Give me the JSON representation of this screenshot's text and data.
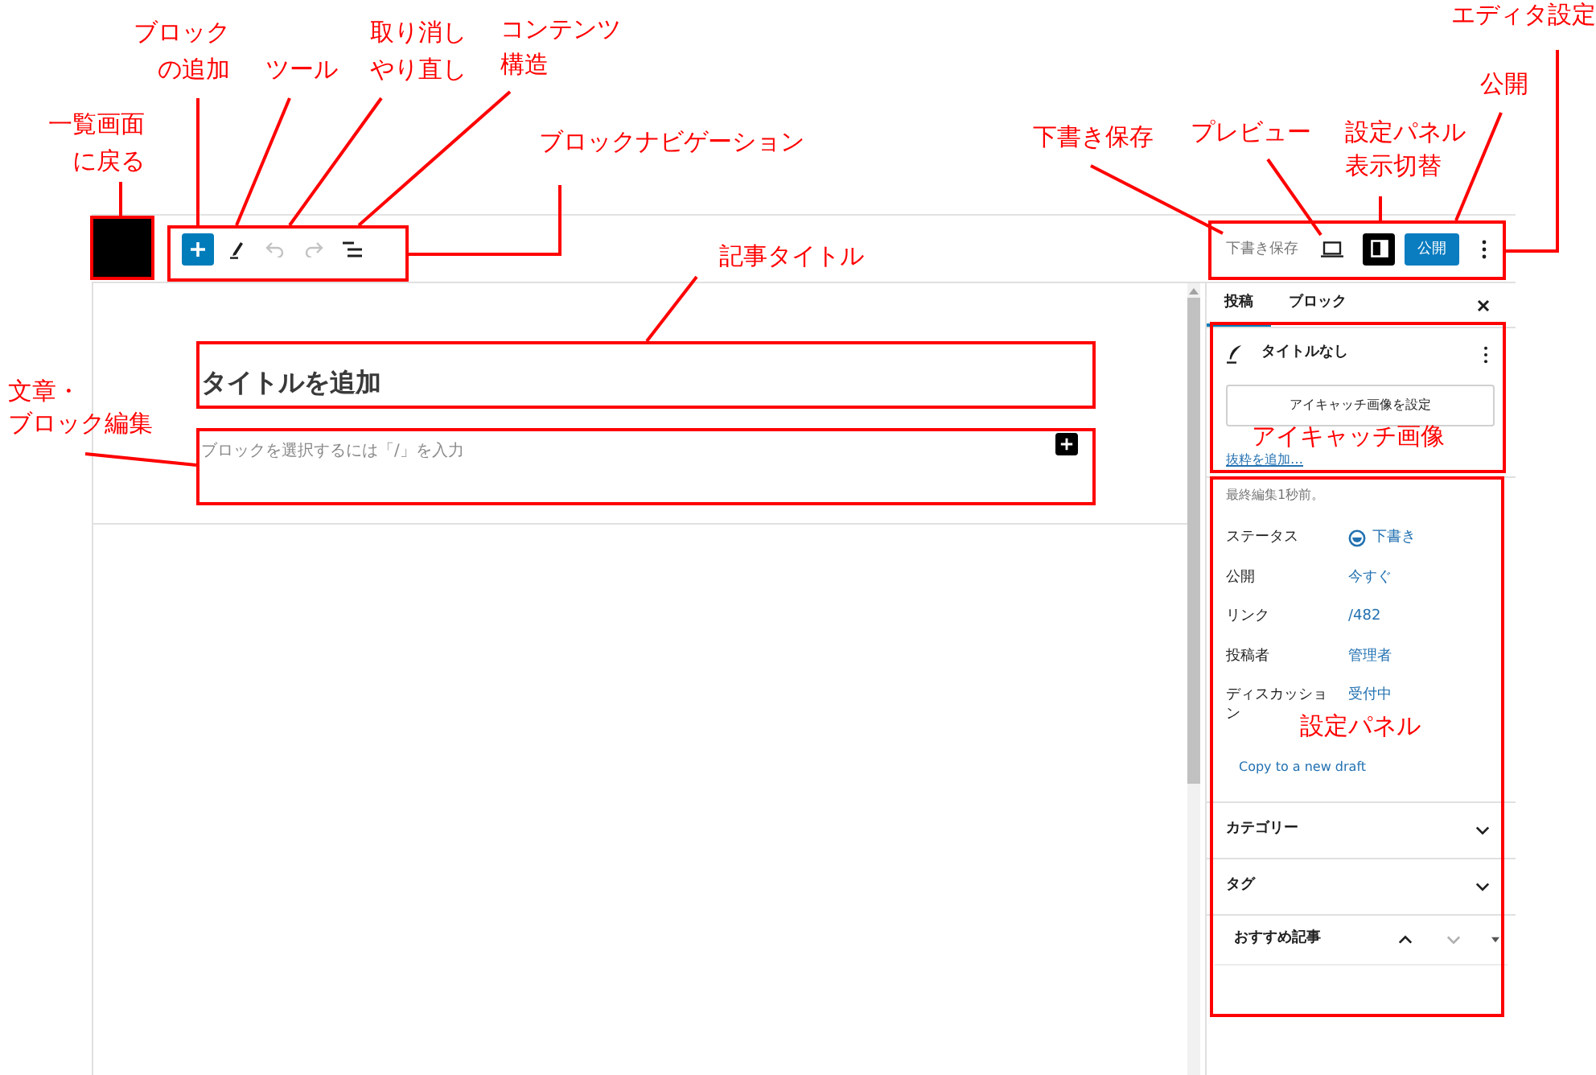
{
  "annotations": [
    {
      "lines": [
        "一覧画面",
        "に戻る"
      ]
    },
    {
      "lines": [
        "ブロック",
        "の追加"
      ]
    },
    {
      "lines": [
        "ツール"
      ]
    },
    {
      "lines": [
        "取り消し",
        "やり直し"
      ]
    },
    {
      "lines": [
        "コンテンツ",
        "構造"
      ]
    },
    {
      "lines": [
        "ブロックナビゲーション"
      ]
    },
    {
      "lines": [
        "記事タイトル"
      ]
    },
    {
      "lines": [
        "文章・",
        "ブロック編集"
      ]
    },
    {
      "lines": [
        "下書き保存"
      ]
    },
    {
      "lines": [
        "プレビュー"
      ]
    },
    {
      "lines": [
        "設定パネル",
        "表示切替"
      ]
    },
    {
      "lines": [
        "公開"
      ]
    },
    {
      "lines": [
        "エディタ設定"
      ]
    },
    {
      "lines": [
        "アイキャッチ画像"
      ]
    },
    {
      "lines": [
        "設定パネル"
      ]
    }
  ],
  "toolbar": [
    {
      "kind": "add",
      "disabled": false
    },
    {
      "kind": "tools",
      "disabled": false
    },
    {
      "kind": "undo",
      "disabled": true
    },
    {
      "kind": "redo",
      "disabled": true
    },
    {
      "kind": "list_view",
      "disabled": false
    }
  ],
  "header_actions": {
    "save_draft": "下書き保存",
    "settings_toggle": {
      "selected": true
    },
    "publish": "公開"
  },
  "canvas": {
    "title": {
      "placeholder": "タイトルを追加"
    },
    "paragraph": {
      "placeholder": "ブロックを選択するには「/」を入力"
    }
  },
  "sidebar": {
    "tabs": [
      {
        "label": "投稿",
        "selected": true
      },
      {
        "label": "ブロック",
        "selected": false
      }
    ],
    "post": {
      "title": "タイトルなし",
      "featured_image_button": "アイキャッチ画像を設定",
      "excerpt_link": "抜粋を追加…"
    },
    "last_edited": "最終編集1秒前。",
    "rows": [
      {
        "kind": "status",
        "label": "ステータス",
        "value": "下書き"
      },
      {
        "kind": "link",
        "label": "公開",
        "value": "今すぐ"
      },
      {
        "kind": "link",
        "label": "リンク",
        "value": "/482"
      },
      {
        "kind": "link",
        "label": "投稿者",
        "value": "管理者"
      },
      {
        "kind": "link",
        "label": "ディスカッション",
        "value": "受付中"
      }
    ],
    "copy_link": "Copy to a new draft",
    "panels": [
      {
        "title": "カテゴリー",
        "expanded": false
      },
      {
        "title": "タグ",
        "expanded": false
      }
    ],
    "metabox": {
      "title": "おすすめ記事",
      "move_up": {
        "disabled": false
      },
      "move_down": {
        "disabled": true
      }
    }
  }
}
